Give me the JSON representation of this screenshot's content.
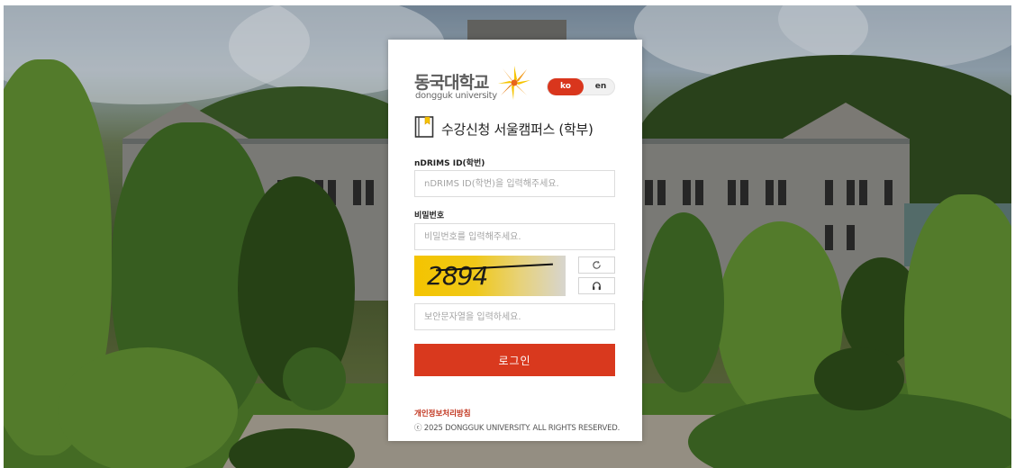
{
  "brand": {
    "name_ko": "동국대학교",
    "name_en": "dongguk university"
  },
  "language": {
    "options": [
      "ko",
      "en"
    ],
    "selected": "ko"
  },
  "page": {
    "title": "수강신청 서울캠퍼스 (학부)"
  },
  "form": {
    "id_label": "nDRIMS ID(학번)",
    "id_placeholder": "nDRIMS ID(학번)을 입력해주세요.",
    "password_label": "비밀번호",
    "password_placeholder": "비밀번호를 입력해주세요.",
    "captcha_text": "2894",
    "captcha_placeholder": "보안문자열을 입력하세요.",
    "login_label": "로그인"
  },
  "footer": {
    "privacy_link": "개인정보처리방침",
    "copyright": "ⓒ 2025 DONGGUK UNIVERSITY. ALL RIGHTS RESERVED."
  },
  "colors": {
    "accent": "#d9391e",
    "emblem_orange": "#f29a1a",
    "emblem_yellow": "#f6c400"
  },
  "icons": {
    "refresh": "refresh-icon",
    "audio": "headphones-icon",
    "title": "book-bookmark-icon"
  }
}
